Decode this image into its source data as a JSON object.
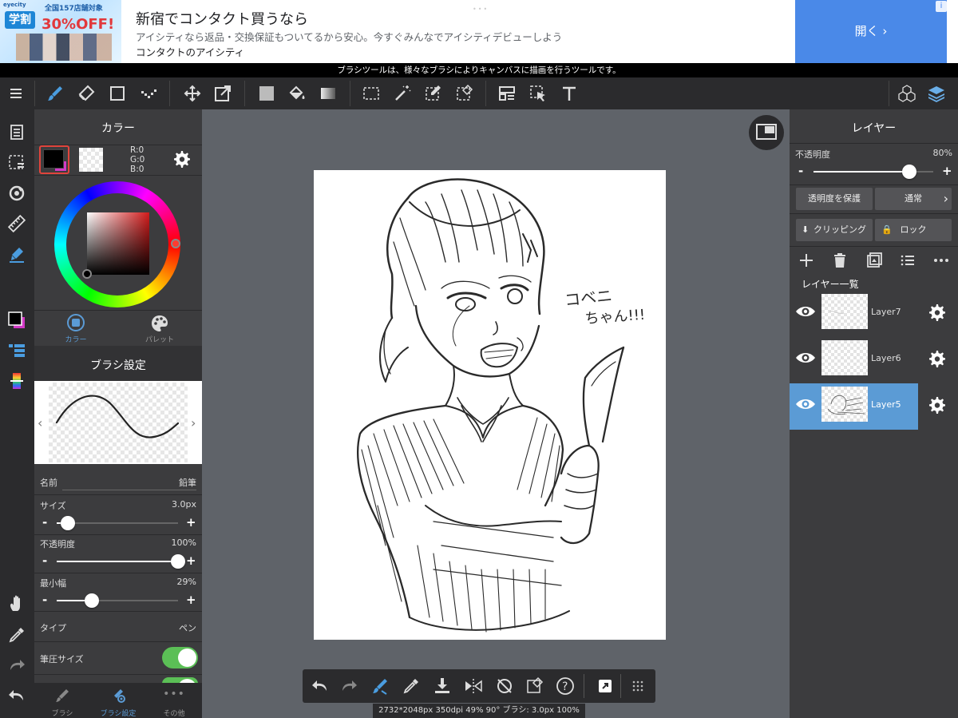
{
  "ad": {
    "brand": "eyecity",
    "top_text": "全国157店舗対象",
    "badge": "学割",
    "discount": "30%OFF!",
    "title": "新宿でコンタクト買うなら",
    "description": "アイシティなら返品・交換保証もついてるから安心。今すぐみんなでアイシティデビューしよう",
    "site": "コンタクトのアイシティ",
    "cta": "開く ›",
    "info": "i"
  },
  "tooltip": "ブラシツールは、様々なブラシによりキャンバスに描画を行うツールです。",
  "toolbar": {
    "icons": [
      "menu-icon",
      "brush-icon",
      "eraser-icon",
      "rectangle-icon",
      "dot-icon",
      "move-icon",
      "transform-icon",
      "fill-color-icon",
      "bucket-icon",
      "gradient-icon",
      "select-rect-icon",
      "magic-wand-icon",
      "select-pen-icon",
      "select-eraser-icon",
      "panel-layout-icon",
      "select-move-icon",
      "text-icon",
      "3d-icon",
      "layers-icon"
    ]
  },
  "color_panel": {
    "title": "カラー",
    "r": "R:0",
    "g": "G:0",
    "b": "B:0",
    "tab_color": "カラー",
    "tab_palette": "パレット",
    "fg_color": "#000000",
    "bg_color": "#ffffff",
    "hue": "#d21b1b"
  },
  "brush_panel": {
    "title": "ブラシ設定",
    "name_label": "名前",
    "name_value": "鉛筆",
    "size_label": "サイズ",
    "size_value": "3.0px",
    "opacity_label": "不透明度",
    "opacity_value": "100%",
    "min_width_label": "最小幅",
    "min_width_value": "29%",
    "type_label": "タイプ",
    "type_value": "ペン",
    "pressure_size_label": "筆圧サイズ",
    "size_level": 0.05,
    "opacity_level": 1.0,
    "min_width_level": 0.29,
    "tab_brush": "ブラシ",
    "tab_brush_settings": "ブラシ設定",
    "tab_other": "その他"
  },
  "layers_panel": {
    "title": "レイヤー",
    "opacity_label": "不透明度",
    "opacity_value": "80%",
    "opacity_level": 0.8,
    "protect_alpha": "透明度を保護",
    "blend_mode": "通常",
    "clipping": "クリッピング",
    "lock": "ロック",
    "list_title": "レイヤー一覧",
    "layers": [
      {
        "name": "Layer7",
        "selected": false
      },
      {
        "name": "Layer6",
        "selected": false
      },
      {
        "name": "Layer5",
        "selected": true
      }
    ]
  },
  "canvas": {
    "annotation_line1": "コベニ",
    "annotation_line2": "ちゃん!!!"
  },
  "status": "2732*2048px 350dpi 49% 90° ブラシ: 3.0px 100%",
  "colors": {
    "accent": "#5b9bd5",
    "selected_layer": "#5b9bd5",
    "toggle_on": "#4cd964",
    "ad_cta": "#4a89e8"
  }
}
